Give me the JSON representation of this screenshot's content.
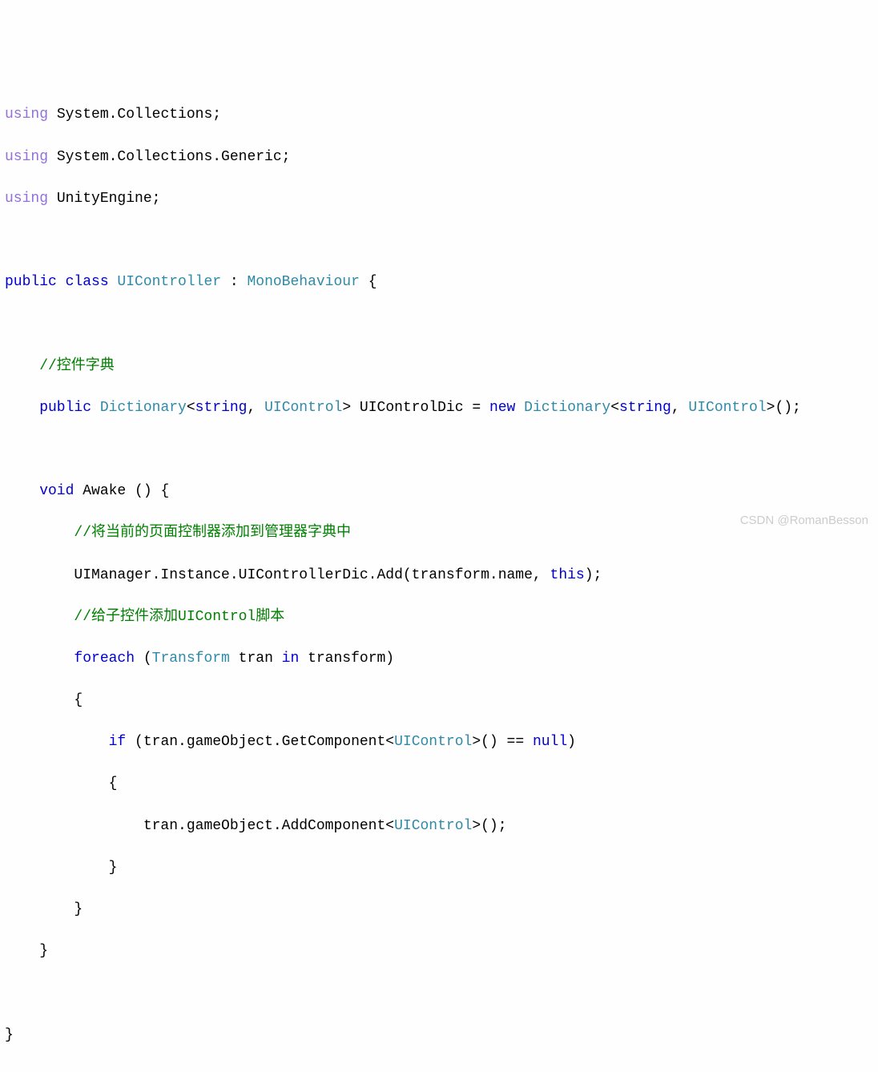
{
  "code": {
    "l1_kw1": "using",
    "l1_ns": " System.Collections;",
    "l2_kw1": "using",
    "l2_ns": " System.Collections.Generic;",
    "l3_kw1": "using",
    "l3_ns": " UnityEngine;",
    "l5_kw1": "public",
    "l5_kw2": " class",
    "l5_type": " UIController",
    "l5_sep": " : ",
    "l5_base": "MonoBehaviour",
    "l5_brace": " {",
    "l7_comment": "    //控件字典",
    "l8_kw1": "    public",
    "l8_type1": " Dictionary",
    "l8_g1": "<",
    "l8_kw2": "string",
    "l8_g2": ", ",
    "l8_type2": "UIControl",
    "l8_g3": "> UIControlDic = ",
    "l8_kw3": "new",
    "l8_type3": " Dictionary",
    "l8_g4": "<",
    "l8_kw4": "string",
    "l8_g5": ", ",
    "l8_type4": "UIControl",
    "l8_g6": ">();",
    "l10_kw1": "    void",
    "l10_m": " Awake () {",
    "l11_comment": "        //将当前的页面控制器添加到管理器字典中",
    "l12_txt1": "        UIManager.Instance.UIControllerDic.Add(transform.name, ",
    "l12_kw": "this",
    "l12_txt2": ");",
    "l13_comment": "        //给子控件添加UIControl脚本",
    "l14_kw1": "        foreach",
    "l14_txt1": " (",
    "l14_type1": "Transform",
    "l14_txt2": " tran ",
    "l14_kw2": "in",
    "l14_txt3": " transform)",
    "l15_b": "        {",
    "l16_kw1": "            if",
    "l16_txt1": " (tran.gameObject.GetComponent<",
    "l16_type1": "UIControl",
    "l16_txt2": ">() == ",
    "l16_kw2": "null",
    "l16_txt3": ")",
    "l17_b": "            {",
    "l18_txt1": "                tran.gameObject.AddComponent<",
    "l18_type1": "UIControl",
    "l18_txt2": ">();",
    "l19_b": "            }",
    "l20_b": "        }",
    "l21_b": "    }",
    "l23_b": "}"
  },
  "watermark": "CSDN @RomanBesson"
}
